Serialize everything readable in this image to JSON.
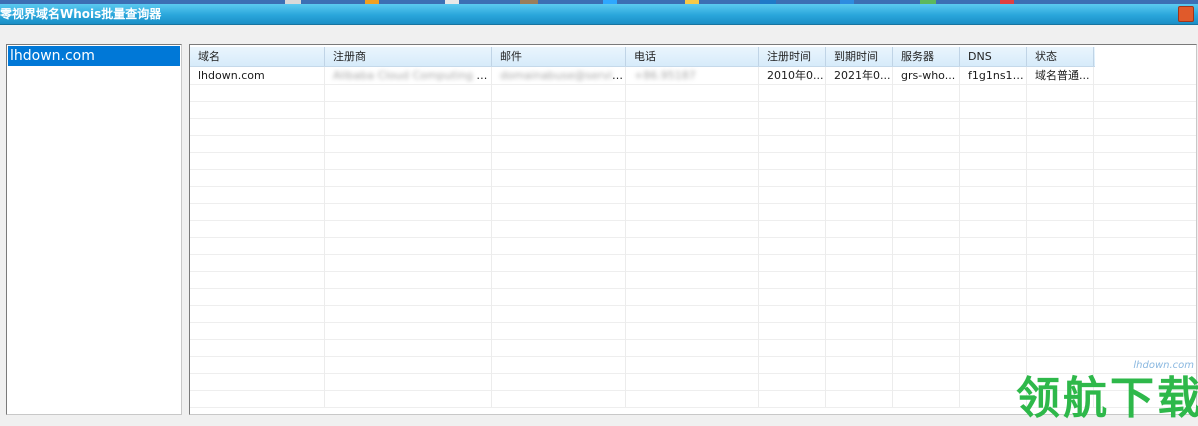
{
  "window": {
    "title": "零视界域名Whois批量查询器"
  },
  "domain_list": {
    "items": [
      {
        "label": "lhdown.com",
        "selected": true
      }
    ]
  },
  "table": {
    "columns": [
      "域名",
      "注册商",
      "邮件",
      "电话",
      "注册时间",
      "到期时间",
      "服务器",
      "DNS",
      "状态"
    ],
    "rows": [
      [
        "lhdown.com",
        "Alibaba Cloud Computing (...",
        "domainabuse@service.aliyun.com",
        "+86.95187",
        "2010年0...",
        "2021年0...",
        "grs-who...",
        "f1g1ns1....",
        "域名普通..."
      ]
    ],
    "obscured_columns": [
      1,
      2,
      3
    ]
  },
  "watermark": {
    "brand": "领航下载",
    "url": "lhdown.com"
  },
  "colors": {
    "titlebar": "#2aa6db",
    "selection": "#0078d7",
    "watermark_green": "#2eb84a"
  }
}
